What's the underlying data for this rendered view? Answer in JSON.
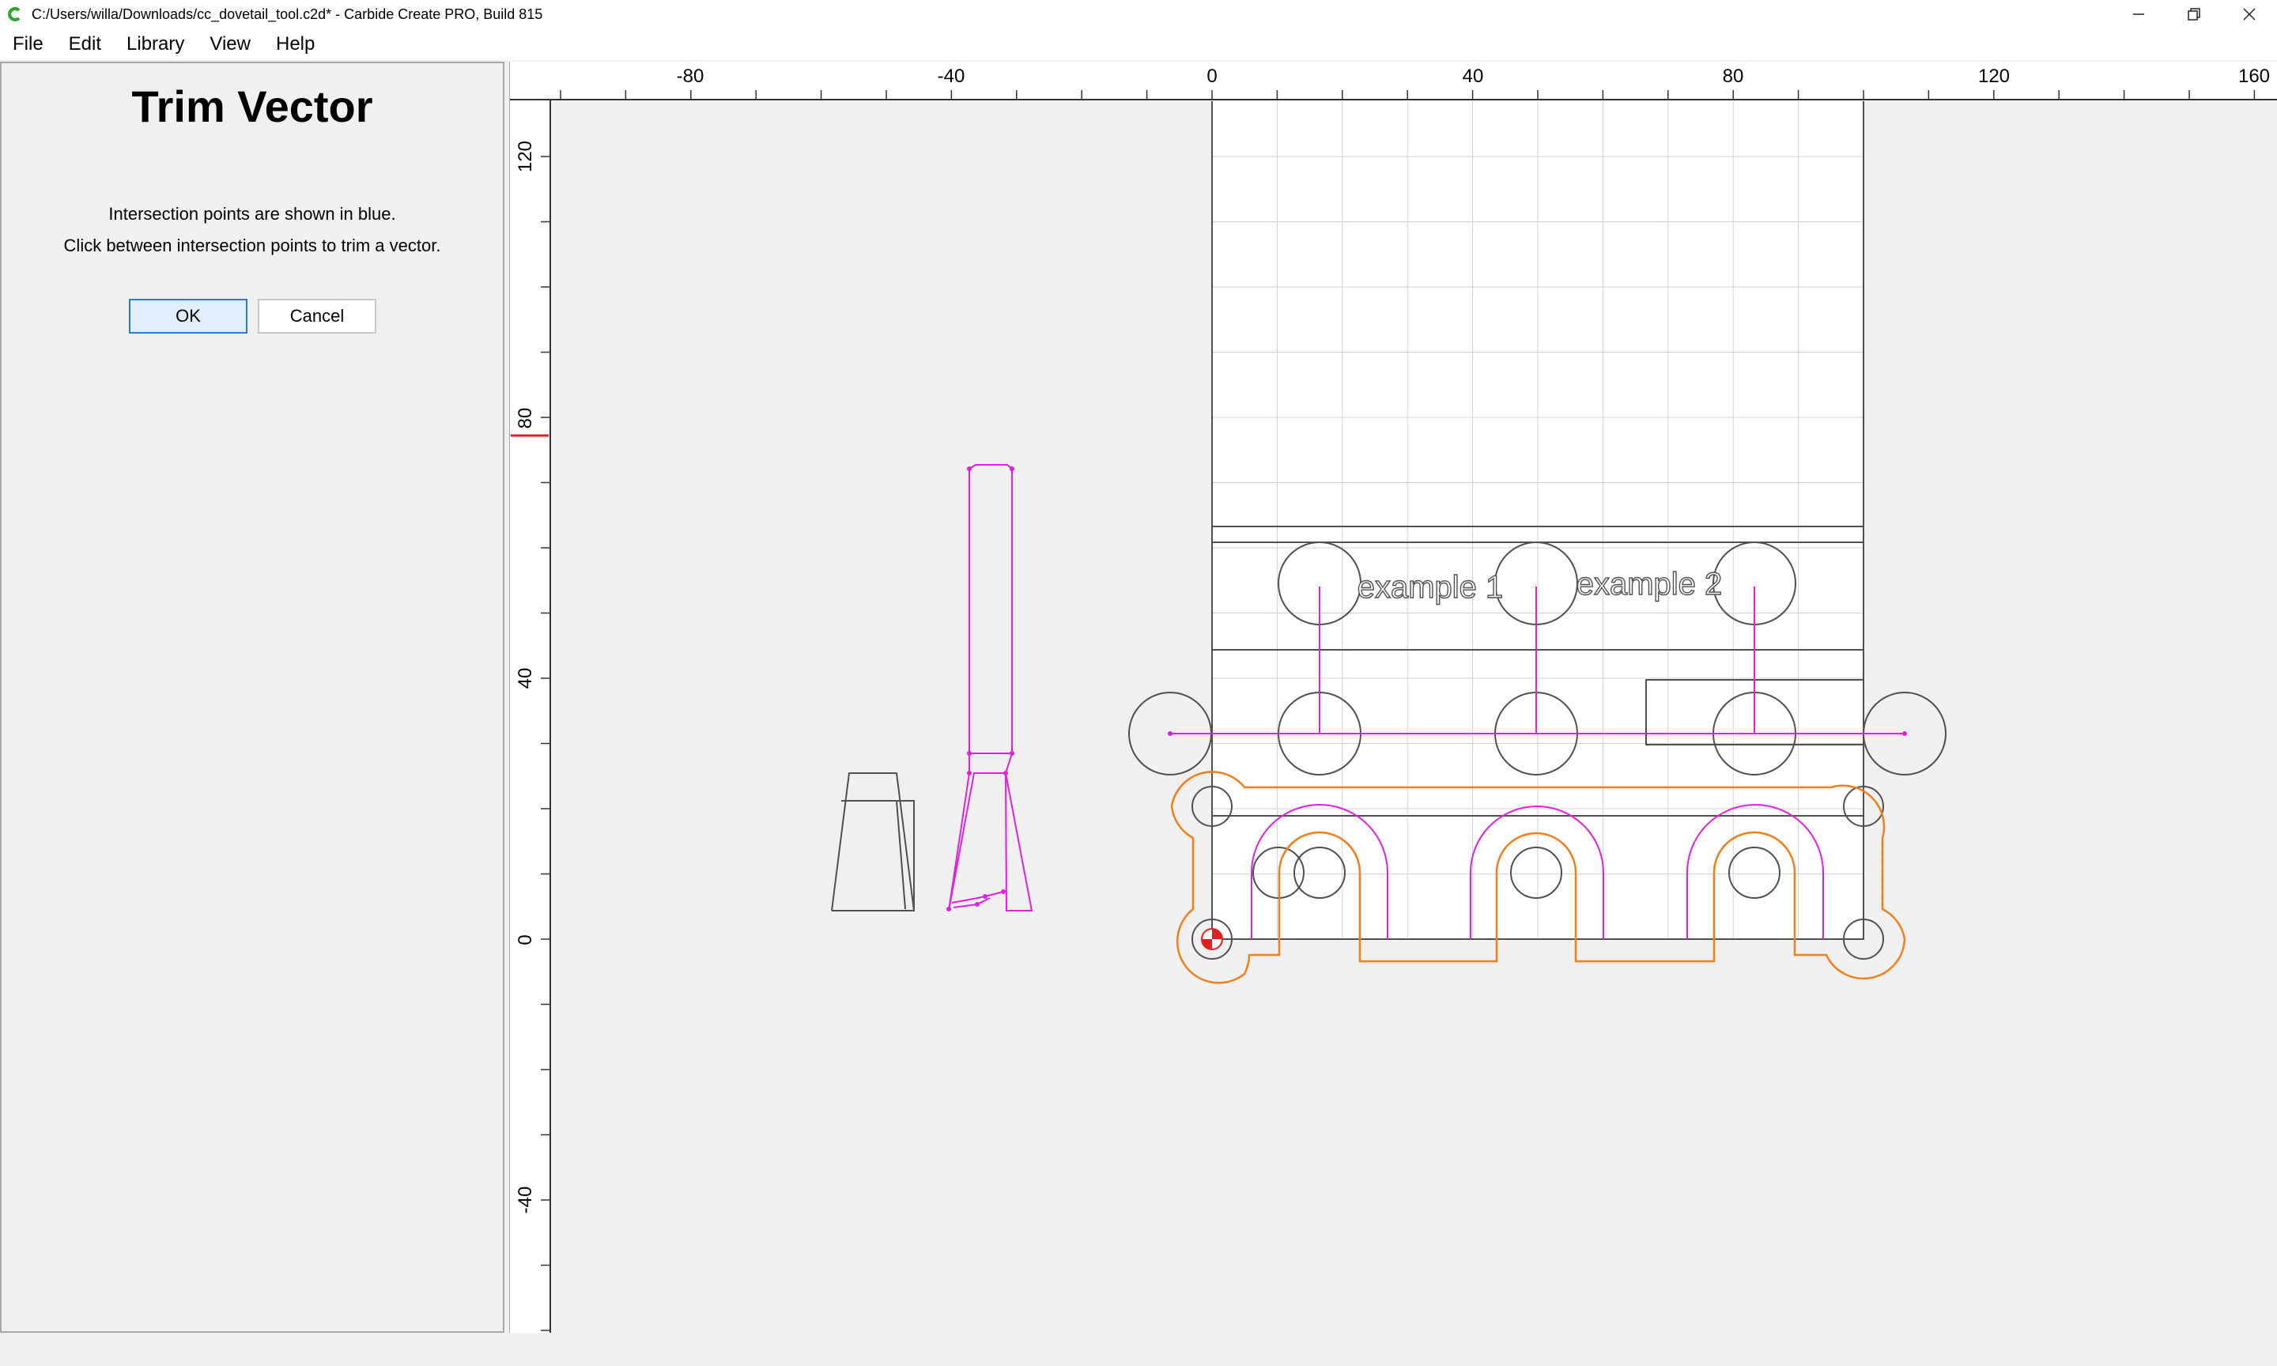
{
  "window": {
    "title": "C:/Users/willa/Downloads/cc_dovetail_tool.c2d* - Carbide Create PRO, Build 815",
    "app_icon": "carbide-create-icon",
    "controls": [
      "minimize-icon",
      "restore-icon",
      "close-icon"
    ]
  },
  "menu": {
    "items": [
      "File",
      "Edit",
      "Library",
      "View",
      "Help"
    ]
  },
  "panel": {
    "title": "Trim Vector",
    "line1": "Intersection points are shown in blue.",
    "line2": "Click between intersection points to trim a vector.",
    "ok_label": "OK",
    "cancel_label": "Cancel"
  },
  "canvas": {
    "x_ticks": [
      "-80",
      "-40",
      "0",
      "40",
      "80",
      "120",
      "160"
    ],
    "y_ticks": [
      "120",
      "80",
      "40",
      "0",
      "-40"
    ],
    "labels": [
      "example 1",
      "example 2"
    ],
    "colors": {
      "toolpath_orange": "#f07f1a",
      "selected_magenta": "#e020e0",
      "geometry": "#505050",
      "grid": "#d2d2d2",
      "origin_red": "#e02020"
    }
  }
}
